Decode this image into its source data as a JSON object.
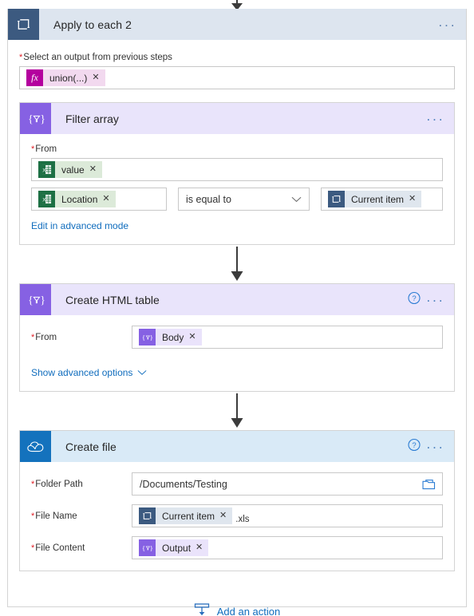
{
  "loop": {
    "title": "Apply to each 2",
    "icon": "loop-icon",
    "menu": "···",
    "input_label": "Select an output from previous steps",
    "required_mark": "*",
    "token": {
      "icon": "fx-icon",
      "icon_text": "fx",
      "label": "union(...)",
      "remove": "✕"
    }
  },
  "filter_array": {
    "title": "Filter array",
    "icon": "filter-braces-icon",
    "menu": "···",
    "from_label": "From",
    "required_mark": "*",
    "from_token": {
      "icon": "excel-icon",
      "label": "value",
      "remove": "✕"
    },
    "condition": {
      "left_token": {
        "icon": "excel-icon",
        "label": "Location",
        "remove": "✕"
      },
      "operator": "is equal to",
      "operator_chevron": "chevron-down-icon",
      "right_token": {
        "icon": "loop-icon",
        "label": "Current item",
        "remove": "✕"
      }
    },
    "advanced_link": "Edit in advanced mode"
  },
  "create_html_table": {
    "title": "Create HTML table",
    "icon": "filter-braces-icon",
    "help": "?",
    "menu": "···",
    "from_label": "From",
    "required_mark": "*",
    "from_token": {
      "icon": "braces-icon",
      "label": "Body",
      "remove": "✕"
    },
    "advanced_link": "Show advanced options",
    "advanced_chevron": "chevron-down-icon"
  },
  "create_file": {
    "title": "Create file",
    "icon": "onedrive-cloud-icon",
    "help": "?",
    "menu": "···",
    "required_mark": "*",
    "fields": [
      {
        "label": "Folder Path",
        "type": "text",
        "value": "/Documents/Testing",
        "trailing_icon": "folder-picker-icon"
      },
      {
        "label": "File Name",
        "type": "token",
        "token": {
          "icon": "loop-icon",
          "label": "Current item",
          "remove": "✕"
        },
        "suffix": ".xls"
      },
      {
        "label": "File Content",
        "type": "token",
        "token": {
          "icon": "braces-icon",
          "label": "Output",
          "remove": "✕"
        }
      }
    ]
  },
  "footer": {
    "add_action_label": "Add an action",
    "add_action_icon": "add-action-icon"
  },
  "colors": {
    "loop_header_bg": "#dde5ef",
    "loop_icon_bg": "#3c5a80",
    "purple_header_bg": "#e9e4fb",
    "purple_icon_bg": "#8661e3",
    "blue_header_bg": "#d9eaf7",
    "blue_icon_bg": "#1472bd",
    "excel_green": "#1d7044",
    "fx_magenta": "#b4009e",
    "link_blue": "#0f6cbd",
    "required_red": "#e01f26"
  }
}
